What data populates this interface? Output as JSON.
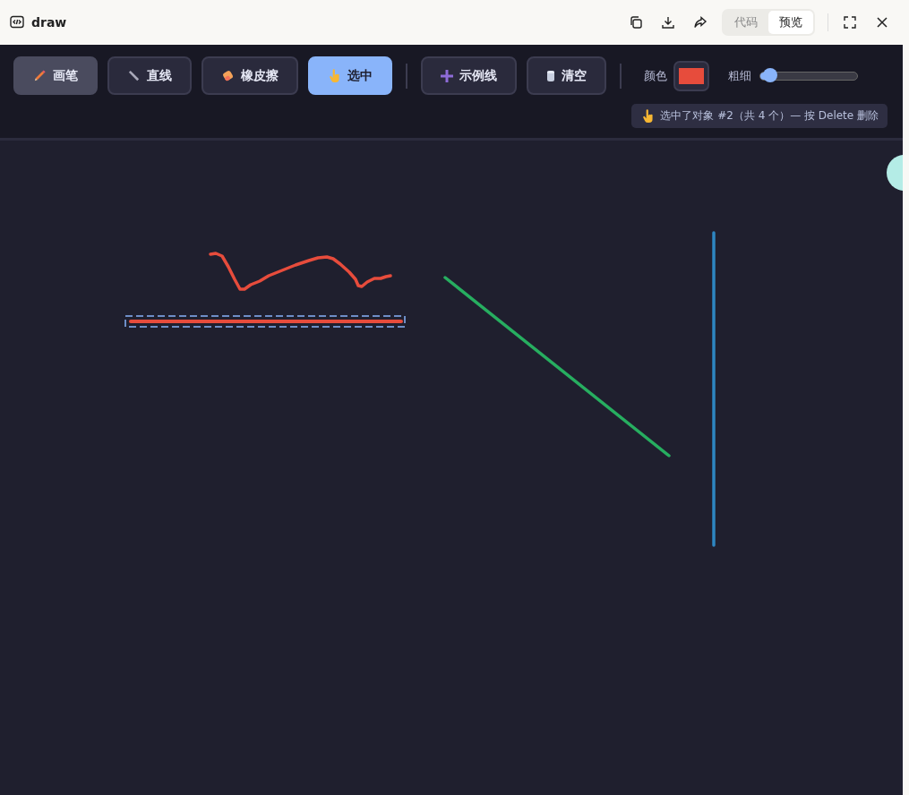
{
  "window": {
    "title": "draw"
  },
  "view_toggle": [
    {
      "label": "代码",
      "selected": false
    },
    {
      "label": "预览",
      "selected": true
    }
  ],
  "tools": [
    {
      "label": "画笔",
      "kind": "pencil",
      "selected": false,
      "highlighted": true
    },
    {
      "label": "直线",
      "kind": "ruler",
      "selected": false,
      "highlighted": false
    },
    {
      "label": "橡皮擦",
      "kind": "eraser",
      "selected": false,
      "highlighted": false
    },
    {
      "label": "选中",
      "kind": "hand",
      "selected": true,
      "highlighted": false
    }
  ],
  "actions": [
    {
      "label": "示例线",
      "kind": "plus"
    },
    {
      "label": "清空",
      "kind": "trash"
    }
  ],
  "color": {
    "label": "颜色",
    "color": "#e74c3c"
  },
  "width": {
    "label": "粗细",
    "level": 0.1
  },
  "status": {
    "text": "选中了对象 #2（共 4 个）— 按 Delete 删除"
  }
}
